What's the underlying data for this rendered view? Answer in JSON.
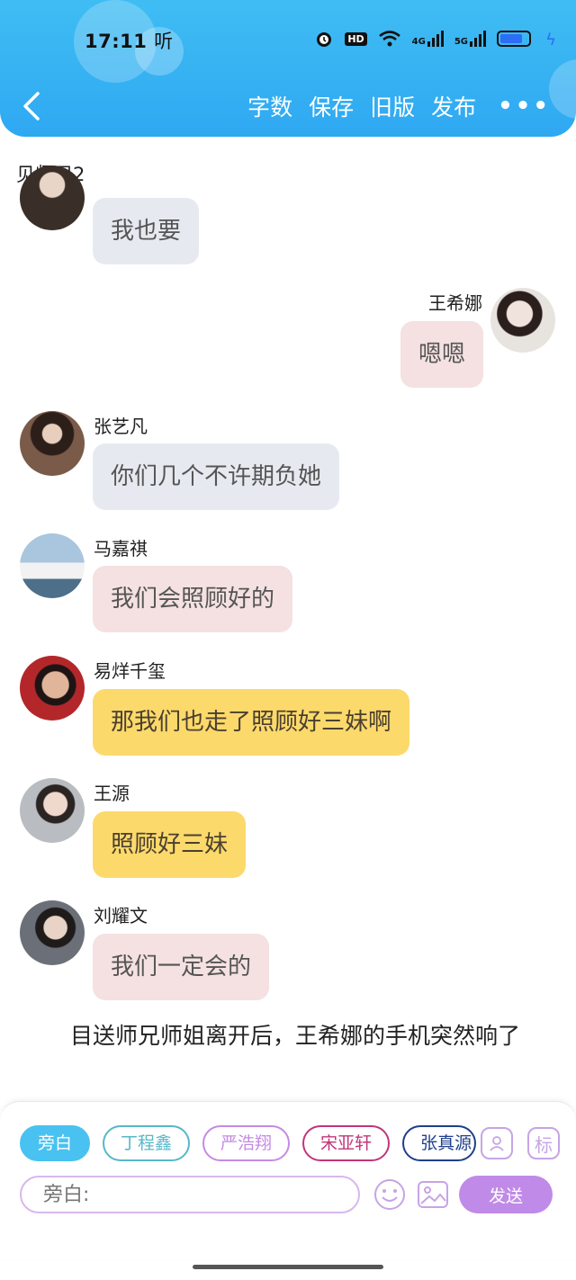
{
  "status": {
    "time": "17:11",
    "carrier_glyph": "听",
    "icons": [
      "alarm-icon",
      "hd-icon",
      "wifi-icon",
      "4g-signal-icon",
      "5g-signal-icon",
      "battery-icon"
    ],
    "hd": "HD",
    "net4g": "4G",
    "net5g": "5G"
  },
  "nav": {
    "back_icon": "chevron-left-icon",
    "word_count": "字数",
    "save": "保存",
    "old_version": "旧版",
    "publish": "发布",
    "more": "•••"
  },
  "chapter_title": "见师兄2",
  "messages": [
    {
      "side": "left",
      "sender": "",
      "text": "我也要",
      "bubble": "grey",
      "avatar_color": "#3a2e28"
    },
    {
      "side": "right",
      "sender": "王希娜",
      "text": "嗯嗯",
      "bubble": "pink",
      "avatar_color": "#d9c8c2"
    },
    {
      "side": "left",
      "sender": "张艺凡",
      "text": "你们几个不许期负她",
      "bubble": "grey",
      "avatar_color": "#6a4a3a"
    },
    {
      "side": "left",
      "sender": "马嘉祺",
      "text": "我们会照顾好的",
      "bubble": "pink",
      "avatar_color": "#7fa6c4"
    },
    {
      "side": "left",
      "sender": "易烊千玺",
      "text": "那我们也走了照顾好三妹啊",
      "bubble": "yellow",
      "avatar_color": "#b3272a"
    },
    {
      "side": "left",
      "sender": "王源",
      "text": "照顾好三妹",
      "bubble": "yellow",
      "avatar_color": "#8a8d92"
    },
    {
      "side": "left",
      "sender": "刘耀文",
      "text": "我们一定会的",
      "bubble": "pink",
      "avatar_color": "#4a4f55"
    }
  ],
  "narration": "目送师兄师姐离开后，王希娜的手机突然响了",
  "roles": [
    {
      "label": "旁白",
      "color": "#49c2f1",
      "active": true
    },
    {
      "label": "丁程鑫",
      "color": "#58b7c9",
      "active": false
    },
    {
      "label": "严浩翔",
      "color": "#c38be3",
      "active": false
    },
    {
      "label": "宋亚轩",
      "color": "#c2357a",
      "active": false
    },
    {
      "label": "张真源",
      "color": "#1f3f8a",
      "active": false
    }
  ],
  "tools": {
    "role_icon": "user-card-icon",
    "tag_label": "标"
  },
  "composer": {
    "placeholder": "旁白:",
    "emoji_icon": "smiley-icon",
    "image_icon": "image-icon",
    "send_label": "发送"
  }
}
